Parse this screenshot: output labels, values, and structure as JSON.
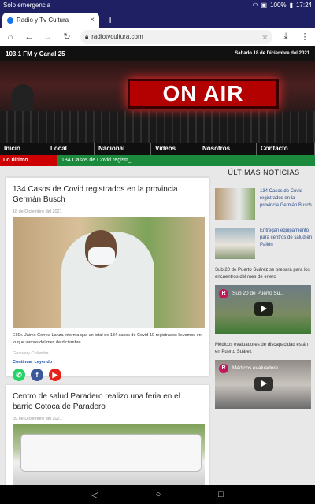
{
  "status": {
    "left": "Solo emergencia",
    "battery": "100%",
    "time": "17:24"
  },
  "browser": {
    "tab_title": "Radio y Tv Cultura",
    "tab_close": "×",
    "new_tab": "+",
    "url": "radiotvcultura.com"
  },
  "site": {
    "station": "103.1 FM y Canal 25",
    "date": "Sabado 18 de Diciembre del 2021",
    "hero_sign": "ON AIR",
    "nav": [
      "Inicio",
      "Local",
      "Nacional",
      "Videos",
      "Nosotros",
      "Contacto"
    ],
    "ticker_label": "Lo último",
    "ticker_text": "134 Casos de Covid registr_"
  },
  "articles": [
    {
      "title": "134 Casos de Covid registrados en la provincia Germán Busch",
      "date": "18 de Diciembre del 2021",
      "excerpt": "El Dr. Jaime Correa Lanza informa que un total de 134 casos de Covid-19 registrados llevamos en lo que vamos del mes de diciembre",
      "author": "Geovany Colomba",
      "more": "Continuar Leyendo"
    },
    {
      "title": "Centro de salud Paradero realizo una feria en el barrio Cotoca de Paradero",
      "date": "09 de Diciembre del 2021"
    }
  ],
  "sidebar": {
    "heading": "ÚLTIMAS NOTICIAS",
    "items": [
      "134 Casos de Covid registrados en la provincia Germán Busch",
      "Entregan equipamiento para centros de salud en Pailón"
    ],
    "videos": [
      {
        "title": "Sub 20 de Puerto Suárez se prepara para los encuentros del mes de enero",
        "overlay": "Sub 20 de Puerto Su...",
        "badge": "R"
      },
      {
        "title": "Médicos evaluadores de discapacidad están en Puerto Suárez",
        "overlay": "Médicos evaluadore...",
        "badge": "R"
      }
    ]
  },
  "colors": {
    "status_bg": "#1f1f63",
    "ticker_label": "#cc0000",
    "ticker_bg": "#1c8a3c",
    "link": "#2a4b8b",
    "facebook": "#3b5998",
    "whatsapp": "#25d366",
    "youtube": "#e62117"
  }
}
